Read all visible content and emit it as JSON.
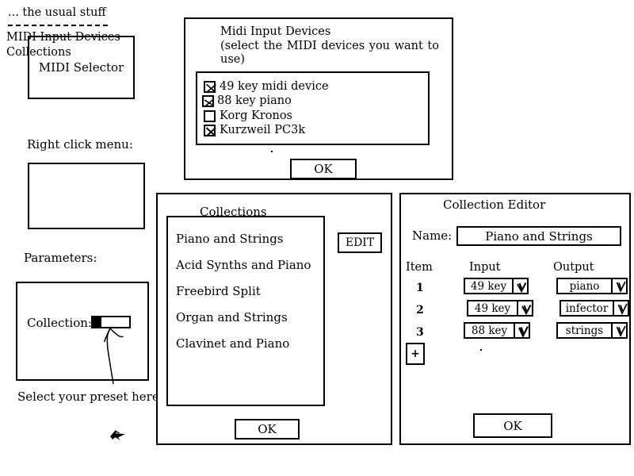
{
  "midi_selector": {
    "title": "MIDI Selector"
  },
  "midi_input_dialog": {
    "title": "Midi Input Devices",
    "subtitle": "(select the MIDI devices you want to use)",
    "devices": [
      {
        "label": "49 key midi device",
        "checked": true
      },
      {
        "label": "88 key piano",
        "checked": true
      },
      {
        "label": "Korg Kronos",
        "checked": false
      },
      {
        "label": "Kurzweil PC3k",
        "checked": true
      }
    ],
    "ok_label": "OK"
  },
  "right_click_menu": {
    "caption": "Right click menu:",
    "items": [
      "... the usual stuff",
      "MIDI Input Devices",
      "Collections"
    ]
  },
  "parameters": {
    "caption": "Parameters:",
    "collection_label": "Collection:",
    "hint": "Select your preset here"
  },
  "collections_panel": {
    "title": "Collections",
    "items": [
      "Piano and Strings",
      "Acid Synths and Piano",
      "Freebird Split",
      "Organ and Strings",
      "Clavinet and Piano"
    ],
    "edit_label": "EDIT",
    "ok_label": "OK"
  },
  "collection_editor": {
    "title": "Collection Editor",
    "name_label": "Name:",
    "name_value": "Piano and Strings",
    "columns": {
      "item": "Item",
      "input": "Input",
      "output": "Output"
    },
    "rows": [
      {
        "num": "1",
        "input": "49 key",
        "output": "piano"
      },
      {
        "num": "2",
        "input": "49 key",
        "output": "infector"
      },
      {
        "num": "3",
        "input": "88 key",
        "output": "strings"
      }
    ],
    "add_label": "+",
    "ok_label": "OK"
  },
  "icons": {
    "checkbox_checked": "checkbox-x-icon",
    "checkbox_unchecked": "checkbox-empty-icon",
    "dropdown_arrow": "chevron-down-icon",
    "pointer_arrow": "hand-drawn-arrow-icon",
    "cursor": "mouse-cursor-icon"
  },
  "colors": {
    "ink": "#000000",
    "paper": "#ffffff"
  }
}
